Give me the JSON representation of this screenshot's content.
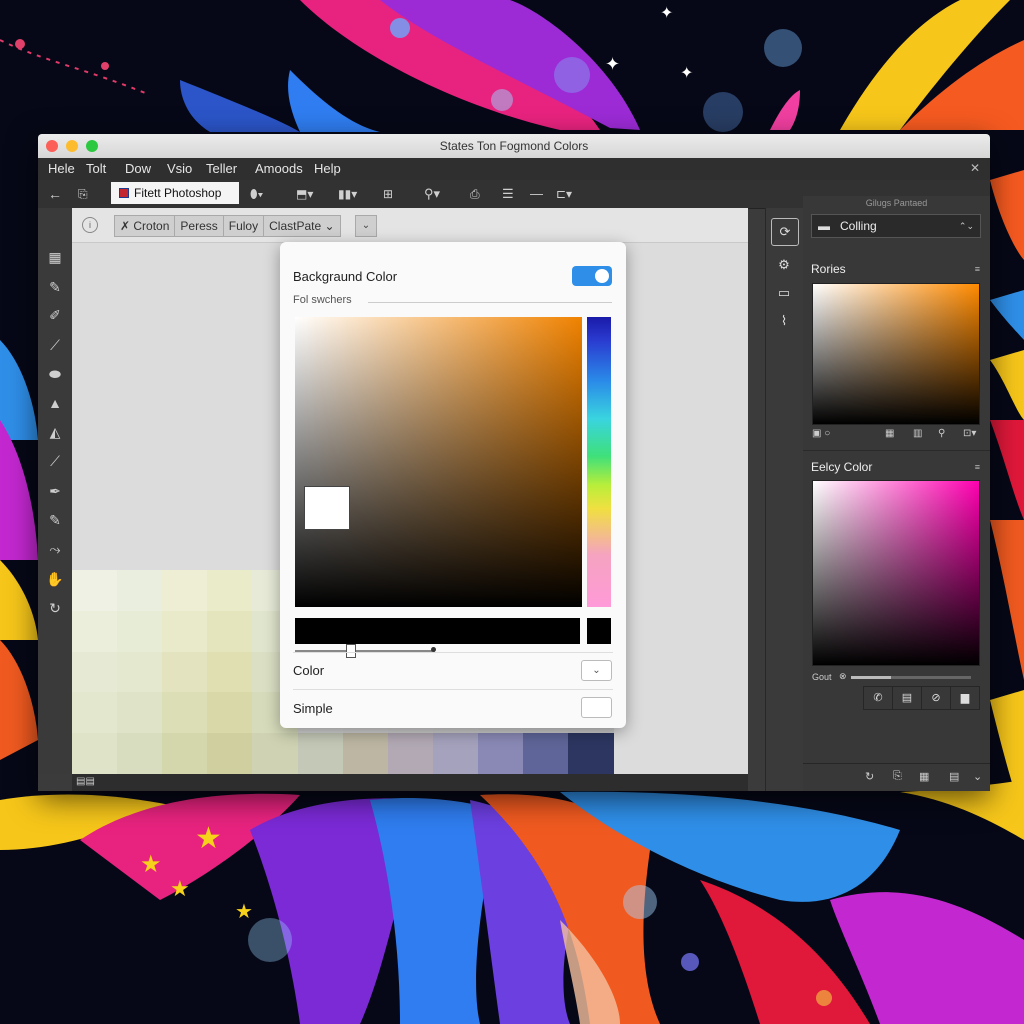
{
  "window": {
    "title": "States Ton Fogmond Colors",
    "close": "✕"
  },
  "menubar": {
    "items": [
      "Hele",
      "Tolt",
      "Dow",
      "Vsio",
      "Teller",
      "Amoods",
      "Help"
    ]
  },
  "toolbar": {
    "back": "←",
    "document_name": "Fitett Photoshop"
  },
  "options_bar": {
    "round": "i",
    "segments": [
      "✗ Croton",
      "Peress",
      "Fuloy",
      "ClastPate  ⌄"
    ],
    "dropdown": "⌄"
  },
  "dialog": {
    "title": "Backgraund Color",
    "subtitle": "Fol swchers",
    "color_label": "Color",
    "color_dropdown": "⌄",
    "simple_label": "Simple",
    "selected_color": "#ffffff",
    "toggle_color": "#2f8fe8"
  },
  "right_panel": {
    "header": "Gilugs Pantaed",
    "search_value": "Colling",
    "section1_title": "Rories",
    "section2_title": "Eelcy Color",
    "slider_label": "Gout",
    "menu_glyph": "≡"
  },
  "swatches": [
    [
      "#eef1e4",
      "#e9eedf",
      "#edeed4",
      "#eaecc9",
      "#e6ead6",
      "#e4e4e4",
      "#e0e0e0",
      "#dedede",
      "#dcdcdc",
      "#dadada",
      "#d9d9d9",
      "#d8d8d8"
    ],
    [
      "#eaeedb",
      "#e7ecd6",
      "#e8eac9",
      "#e4e5bc",
      "#e0e5cd",
      "#dedede",
      "#dcdcdc",
      "#dadada",
      "#d8d8d8",
      "#d6d6d6",
      "#d5d5d5",
      "#d4d4d4"
    ],
    [
      "#e6ead4",
      "#e3e8cf",
      "#e3e4bf",
      "#dfdfb2",
      "#dbe0c4",
      "#d9d9d9",
      "#d7d7d7",
      "#d5d5d5",
      "#d3d3d3",
      "#d2d2d2",
      "#d1d1d1",
      "#d0d0d0"
    ],
    [
      "#e3e7ce",
      "#dfe4c8",
      "#dcdeb6",
      "#d8d8a8",
      "#d6dbbb",
      "#d4d4d4",
      "#d2d2d2",
      "#d0d0d0",
      "#cfcfcf",
      "#cecece",
      "#cdcdcd",
      "#cccccc"
    ],
    [
      "#dfe3c7",
      "#d8ddc0",
      "#d4d6ac",
      "#d0cf9f",
      "#cfd3b3",
      "#c4c8b6",
      "#bcb6a2",
      "#b2a9b4",
      "#a5a2bd",
      "#8a89b6",
      "#5f6598",
      "#2c3660"
    ]
  ]
}
